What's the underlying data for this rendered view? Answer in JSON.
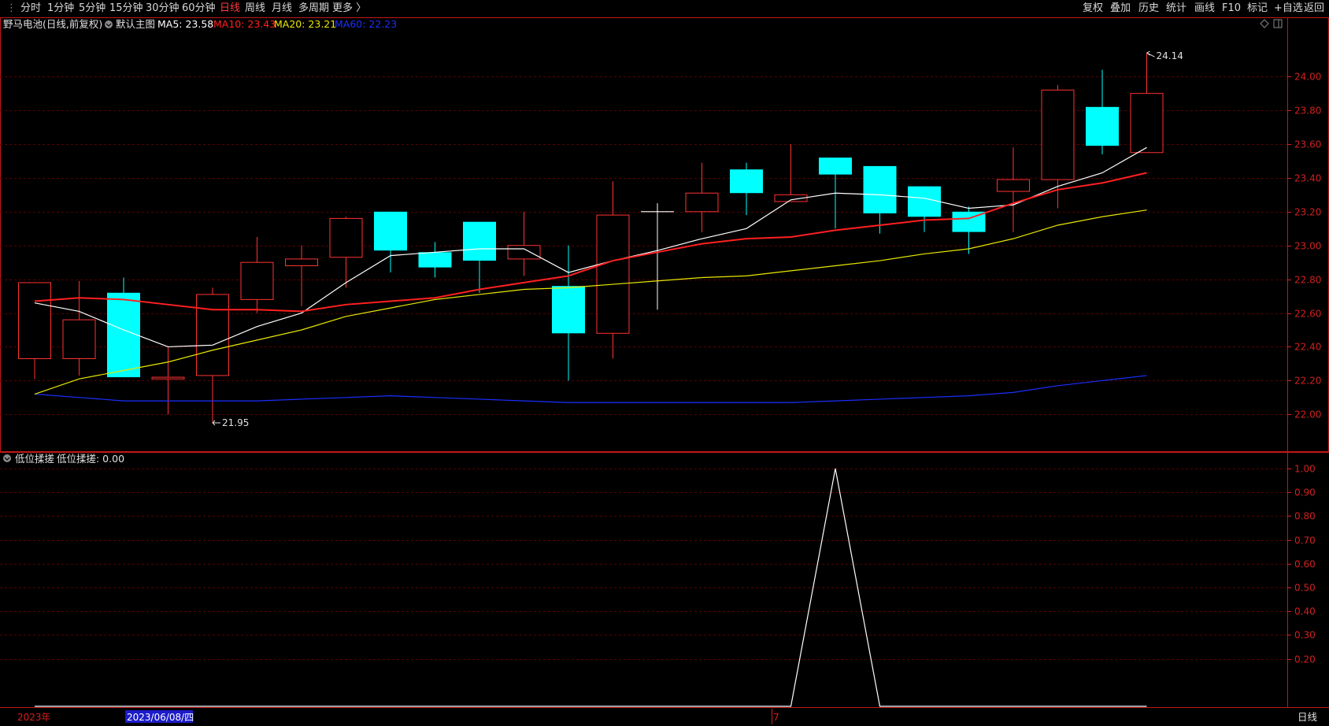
{
  "toolbar": {
    "left": [
      "分时",
      "1分钟",
      "5分钟",
      "15分钟",
      "30分钟",
      "60分钟",
      "日线",
      "周线",
      "月线",
      "多周期",
      "更多 〉"
    ],
    "active": "日线",
    "right": [
      "复权",
      "叠加",
      "历史",
      "统计",
      "画线",
      "F10",
      "标记",
      "+自选",
      "返回"
    ]
  },
  "main_legend": {
    "stock": "野马电池(日线,前复权)",
    "chart_name": "默认主图",
    "ma5": "MA5: 23.58",
    "ma10": "MA10: 23.43",
    "ma20": "MA20: 23.21",
    "ma60": "MA60: 22.23"
  },
  "sub_legend": {
    "name": "低位揉搓",
    "value": "低位揉搓: 0.00"
  },
  "bottom_bar": {
    "year_label": "2023年",
    "cursor_date": "2023/06/08/四",
    "month_label": "7",
    "period": "日线"
  },
  "annotations": {
    "high": "24.14",
    "low": "21.95"
  },
  "colors": {
    "up": "#ff3232",
    "down": "#00ffff",
    "ma5": "#ffffff",
    "ma10": "#ff2020",
    "ma20": "#e8e800",
    "ma60": "#1a2fff",
    "axis": "#d02020",
    "grid": "#5a0000"
  },
  "chart_data": [
    {
      "type": "candlestick",
      "title": "野马电池(日线,前复权)",
      "y_ticks": [
        "22.00",
        "22.20",
        "22.40",
        "22.60",
        "22.80",
        "23.00",
        "23.20",
        "23.40",
        "23.60",
        "23.80",
        "24.00"
      ],
      "ylim": [
        21.88,
        24.22
      ],
      "candles": [
        {
          "o": 22.33,
          "h": 22.78,
          "l": 22.21,
          "c": 22.78
        },
        {
          "o": 22.33,
          "h": 22.79,
          "l": 22.23,
          "c": 22.56
        },
        {
          "o": 22.72,
          "h": 22.81,
          "l": 22.22,
          "c": 22.22
        },
        {
          "o": 22.21,
          "h": 22.4,
          "l": 22.0,
          "c": 22.22
        },
        {
          "o": 22.23,
          "h": 22.75,
          "l": 21.95,
          "c": 22.71
        },
        {
          "o": 22.68,
          "h": 23.05,
          "l": 22.6,
          "c": 22.9
        },
        {
          "o": 22.88,
          "h": 23.0,
          "l": 22.64,
          "c": 22.92
        },
        {
          "o": 22.93,
          "h": 23.17,
          "l": 22.75,
          "c": 23.16
        },
        {
          "o": 23.2,
          "h": 23.2,
          "l": 22.84,
          "c": 22.97
        },
        {
          "o": 22.96,
          "h": 23.02,
          "l": 22.81,
          "c": 22.87
        },
        {
          "o": 23.14,
          "h": 23.14,
          "l": 22.72,
          "c": 22.91
        },
        {
          "o": 22.92,
          "h": 23.2,
          "l": 22.82,
          "c": 23.0
        },
        {
          "o": 22.76,
          "h": 23.0,
          "l": 22.2,
          "c": 22.48
        },
        {
          "o": 22.48,
          "h": 23.38,
          "l": 22.33,
          "c": 23.18
        },
        {
          "o": 23.2,
          "h": 23.25,
          "l": 22.62,
          "c": 23.2
        },
        {
          "o": 23.2,
          "h": 23.49,
          "l": 23.08,
          "c": 23.31
        },
        {
          "o": 23.45,
          "h": 23.49,
          "l": 23.18,
          "c": 23.31
        },
        {
          "o": 23.26,
          "h": 23.6,
          "l": 23.26,
          "c": 23.3
        },
        {
          "o": 23.52,
          "h": 23.52,
          "l": 23.1,
          "c": 23.42
        },
        {
          "o": 23.47,
          "h": 23.47,
          "l": 23.07,
          "c": 23.19
        },
        {
          "o": 23.35,
          "h": 23.35,
          "l": 23.08,
          "c": 23.17
        },
        {
          "o": 23.2,
          "h": 23.23,
          "l": 22.95,
          "c": 23.08
        },
        {
          "o": 23.32,
          "h": 23.58,
          "l": 23.08,
          "c": 23.39
        },
        {
          "o": 23.39,
          "h": 23.95,
          "l": 23.22,
          "c": 23.92
        },
        {
          "o": 23.82,
          "h": 24.04,
          "l": 23.54,
          "c": 23.59
        },
        {
          "o": 23.55,
          "h": 24.14,
          "l": 23.55,
          "c": 23.9
        }
      ],
      "ma5": [
        22.66,
        22.61,
        22.5,
        22.4,
        22.41,
        22.52,
        22.6,
        22.78,
        22.94,
        22.96,
        22.98,
        22.98,
        22.84,
        22.91,
        22.97,
        23.04,
        23.1,
        23.27,
        23.31,
        23.3,
        23.28,
        23.22,
        23.24,
        23.35,
        23.43,
        23.58
      ],
      "ma10": [
        22.67,
        22.69,
        22.68,
        22.65,
        22.62,
        22.62,
        22.61,
        22.65,
        22.67,
        22.69,
        22.74,
        22.78,
        22.82,
        22.91,
        22.96,
        23.01,
        23.04,
        23.05,
        23.09,
        23.12,
        23.15,
        23.16,
        23.25,
        23.33,
        23.37,
        23.43
      ],
      "ma20": [
        22.12,
        22.21,
        22.26,
        22.31,
        22.38,
        22.44,
        22.5,
        22.58,
        22.63,
        22.68,
        22.71,
        22.74,
        22.75,
        22.77,
        22.79,
        22.81,
        22.82,
        22.85,
        22.88,
        22.91,
        22.95,
        22.98,
        23.04,
        23.12,
        23.17,
        23.21
      ],
      "ma60": [
        22.12,
        22.1,
        22.08,
        22.08,
        22.08,
        22.08,
        22.09,
        22.1,
        22.11,
        22.1,
        22.09,
        22.08,
        22.07,
        22.07,
        22.07,
        22.07,
        22.07,
        22.07,
        22.08,
        22.09,
        22.1,
        22.11,
        22.13,
        22.17,
        22.2,
        22.23
      ]
    },
    {
      "type": "line",
      "title": "低位揉搓",
      "y_ticks": [
        "0.20",
        "0.30",
        "0.40",
        "0.50",
        "0.60",
        "0.70",
        "0.80",
        "0.90",
        "1.00"
      ],
      "ylim": [
        0,
        1
      ],
      "values": [
        0,
        0,
        0,
        0,
        0,
        0,
        0,
        0,
        0,
        0,
        0,
        0,
        0,
        0,
        0,
        0,
        0,
        0,
        1,
        0,
        0,
        0,
        0,
        0,
        0,
        0
      ]
    }
  ]
}
